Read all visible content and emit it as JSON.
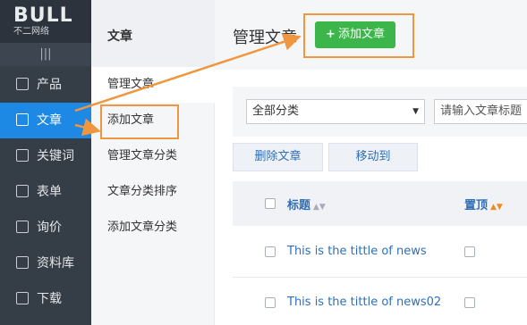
{
  "logo": {
    "main": "BULL",
    "sub": "不二网络"
  },
  "sidebar": {
    "collapse_glyph": "|||",
    "items": [
      {
        "label": "产品",
        "icon": "grid-icon"
      },
      {
        "label": "文章",
        "icon": "document-icon",
        "active": true
      },
      {
        "label": "关键词",
        "icon": "keyword-icon"
      },
      {
        "label": "表单",
        "icon": "form-icon"
      },
      {
        "label": "询价",
        "icon": "inquiry-icon"
      },
      {
        "label": "资料库",
        "icon": "database-icon"
      },
      {
        "label": "下载",
        "icon": "download-icon"
      }
    ]
  },
  "subnav": {
    "heading": "文章",
    "items": [
      {
        "label": "管理文章"
      },
      {
        "label": "添加文章",
        "active": true
      },
      {
        "label": "管理文章分类"
      },
      {
        "label": "文章分类排序"
      },
      {
        "label": "添加文章分类"
      }
    ]
  },
  "main": {
    "title": "管理文章",
    "add_button": "添加文章",
    "add_button_icon": "plus",
    "category_select": "全部分类",
    "search_placeholder": "请输入文章标题",
    "delete_button": "删除文章",
    "move_button": "移动到",
    "columns": {
      "title": "标题",
      "pin": "置顶"
    },
    "rows": [
      {
        "title": "This is the tittle of news"
      },
      {
        "title": "This is the tittle of news02"
      }
    ]
  },
  "colors": {
    "sidebar_bg": "#353d47",
    "active_blue": "#1e88e5",
    "add_green": "#3cb64a",
    "annotation_orange": "#f0963f"
  }
}
